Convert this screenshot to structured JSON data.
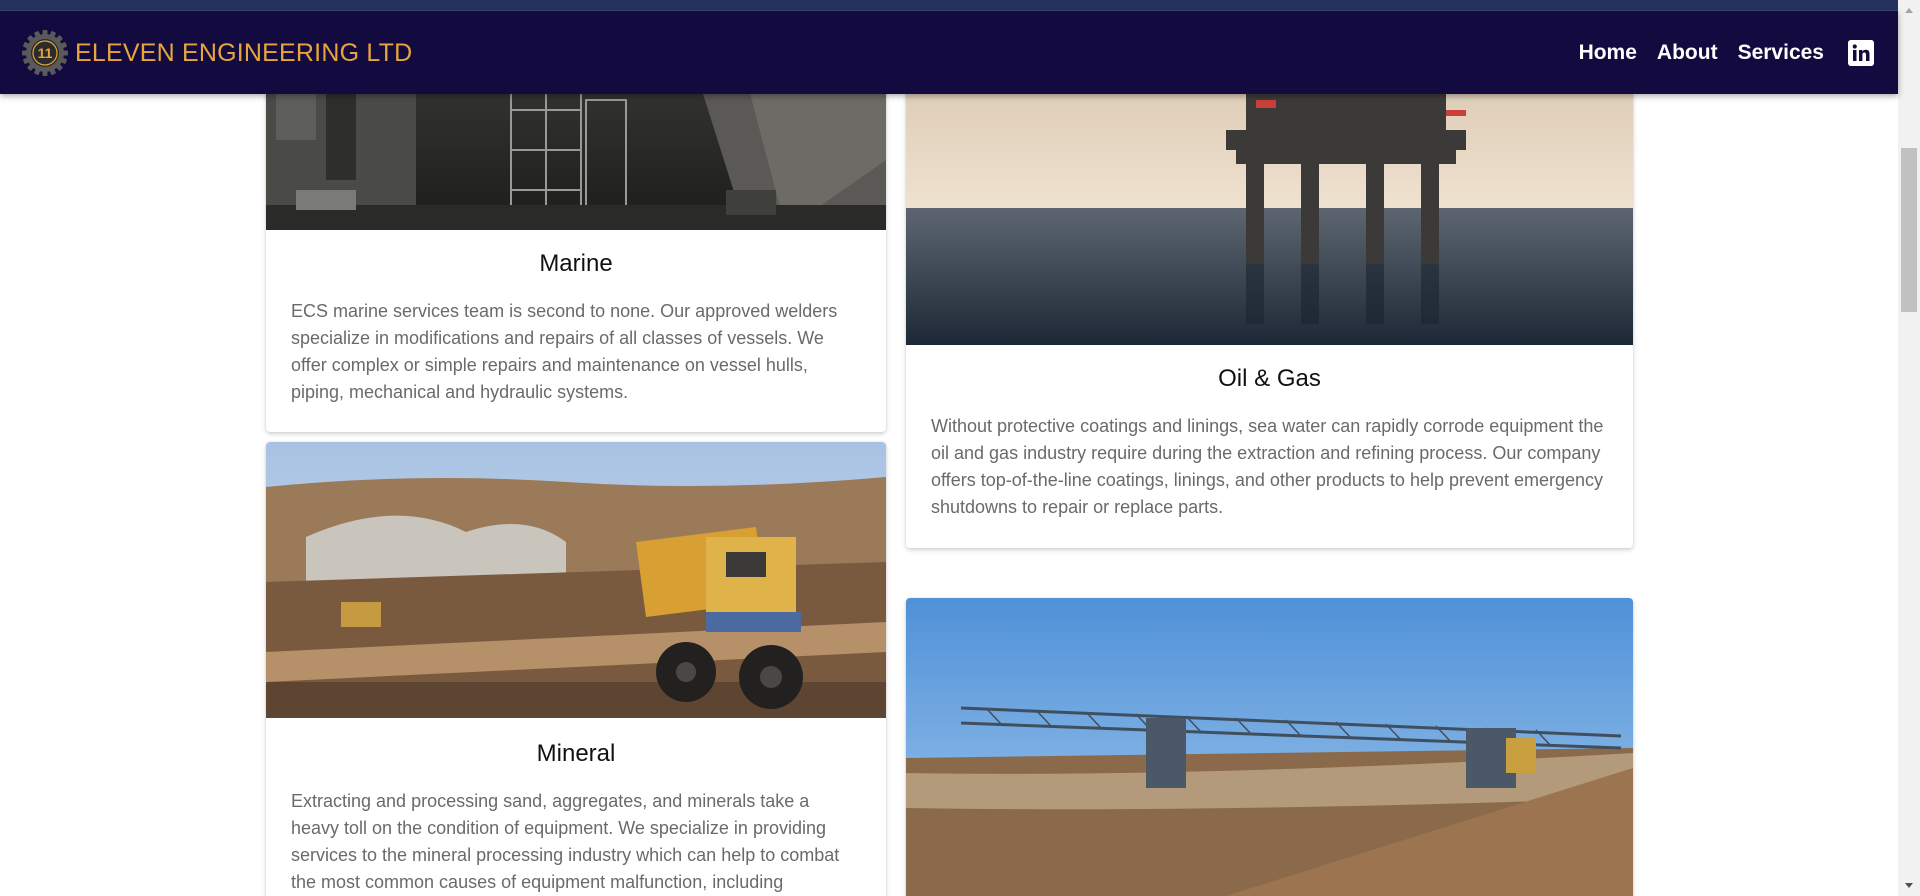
{
  "brand": {
    "name": "ELEVEN ENGINEERING LTD",
    "logo_text": "11",
    "logo_color": "#e8a53b"
  },
  "nav": {
    "links": [
      "Home",
      "About",
      "Services"
    ],
    "linkedin_icon": "linkedin-icon"
  },
  "colors": {
    "navbar_bg": "#130a3f",
    "brand_accent": "#e8a53b"
  },
  "cards": {
    "marine": {
      "title": "Marine",
      "text": "ECS marine services team is second to none. Our approved welders specialize in modifications and repairs of all classes of vessels. We offer complex or simple repairs and maintenance on vessel hulls, piping, mechanical and hydraulic systems."
    },
    "oil": {
      "title": "Oil & Gas",
      "text": "Without protective coatings and linings, sea water can rapidly corrode equipment the oil and gas industry require during the extraction and refining process. Our company offers top-of-the-line coatings, linings, and other products to help prevent emergency shutdowns to repair or replace parts."
    },
    "mineral": {
      "title": "Mineral",
      "text": "Extracting and processing sand, aggregates, and minerals take a heavy toll on the condition of equipment. We specialize in providing services to the mineral processing industry which can help to combat the most common causes of equipment malfunction, including abrasion,"
    }
  }
}
